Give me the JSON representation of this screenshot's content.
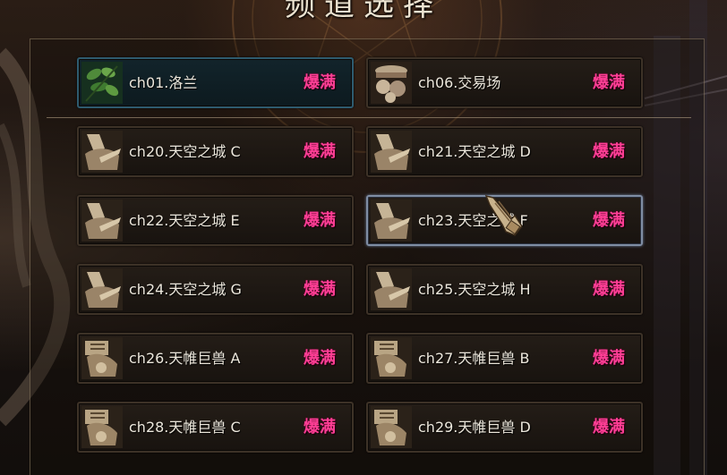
{
  "title": "频道选择",
  "channels": [
    {
      "name": "ch01.洛兰",
      "status": "爆满",
      "icon": "forest-leaves-icon"
    },
    {
      "name": "ch06.交易场",
      "status": "爆满",
      "icon": "trade-market-icon"
    },
    {
      "name": "ch20.天空之城 C",
      "status": "爆满",
      "icon": "sky-castle-icon"
    },
    {
      "name": "ch21.天空之城 D",
      "status": "爆满",
      "icon": "sky-castle-icon"
    },
    {
      "name": "ch22.天空之城 E",
      "status": "爆满",
      "icon": "sky-castle-icon"
    },
    {
      "name": "ch23.天空之城 F",
      "status": "爆满",
      "icon": "sky-castle-icon"
    },
    {
      "name": "ch24.天空之城 G",
      "status": "爆满",
      "icon": "sky-castle-icon"
    },
    {
      "name": "ch25.天空之城 H",
      "status": "爆满",
      "icon": "sky-castle-icon"
    },
    {
      "name": "ch26.天帷巨兽 A",
      "status": "爆满",
      "icon": "giant-beast-icon"
    },
    {
      "name": "ch27.天帷巨兽 B",
      "status": "爆满",
      "icon": "giant-beast-icon"
    },
    {
      "name": "ch28.天帷巨兽 C",
      "status": "爆满",
      "icon": "giant-beast-icon"
    },
    {
      "name": "ch29.天帷巨兽 D",
      "status": "爆满",
      "icon": "giant-beast-icon"
    }
  ],
  "colors": {
    "status": "#ff3f96",
    "channel_text": "#ece7dc",
    "selected_border": "#2e5b6f",
    "hover_border": "#7f8da3"
  }
}
